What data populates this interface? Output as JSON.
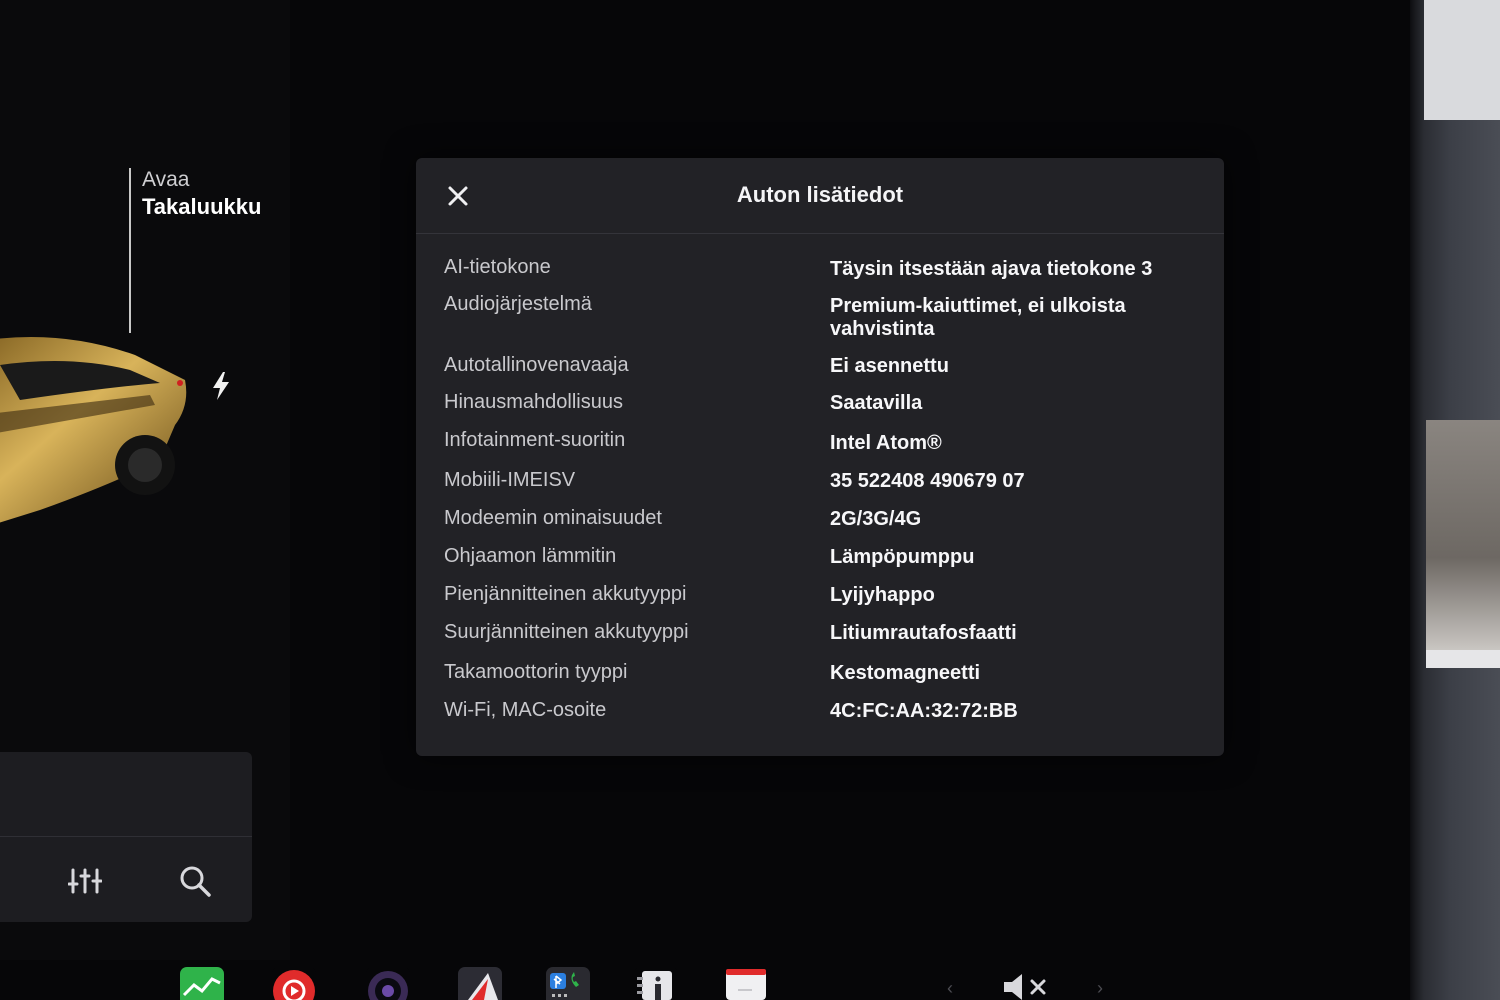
{
  "vehicle": {
    "trunk_action_top": "Avaa",
    "trunk_action_main": "Takaluukku"
  },
  "modal": {
    "title": "Auton lisätiedot",
    "rows": [
      {
        "label": "AI-tietokone",
        "value": "Täysin itsestään ajava tietokone 3"
      },
      {
        "label": "Audiojärjestelmä",
        "value": "Premium-kaiuttimet, ei ulkoista vahvistinta"
      },
      {
        "label": "Autotallinovenavaaja",
        "value": "Ei asennettu"
      },
      {
        "label": "Hinausmahdollisuus",
        "value": "Saatavilla"
      },
      {
        "label": "Infotainment-suoritin",
        "value": "Intel Atom®"
      },
      {
        "label": "Mobiili-IMEISV",
        "value": "35 522408 490679 07"
      },
      {
        "label": "Modeemin ominaisuudet",
        "value": "2G/3G/4G"
      },
      {
        "label": "Ohjaamon lämmitin",
        "value": "Lämpöpumppu"
      },
      {
        "label": "Pienjännitteinen akkutyyppi",
        "value": "Lyijyhappo"
      },
      {
        "label": "Suurjännitteinen akkutyyppi",
        "value": "Litiumrautafosfaatti"
      },
      {
        "label": "Takamoottorin tyyppi",
        "value": "Kestomagneetti"
      },
      {
        "label": "Wi-Fi, MAC-osoite",
        "value": "4C:FC:AA:32:72:BB"
      }
    ]
  },
  "icons": {
    "close": "close-icon",
    "charge": "lightning-icon",
    "equalizer": "equalizer-icon",
    "search": "search-icon",
    "mute": "volume-muted-icon"
  },
  "dock": {
    "apps": [
      "energy-app-icon",
      "media-player-app-icon",
      "camera-app-icon",
      "navigation-app-icon",
      "phone-bluetooth-app-icon",
      "info-app-icon",
      "calendar-app-icon"
    ],
    "chevron_left": "‹",
    "chevron_right": "›"
  },
  "colors": {
    "modal_bg": "#222226",
    "screen_bg": "#060608",
    "car_gold": "#c9a24a",
    "energy_green": "#2fb34a",
    "media_red": "#e02b2b"
  }
}
